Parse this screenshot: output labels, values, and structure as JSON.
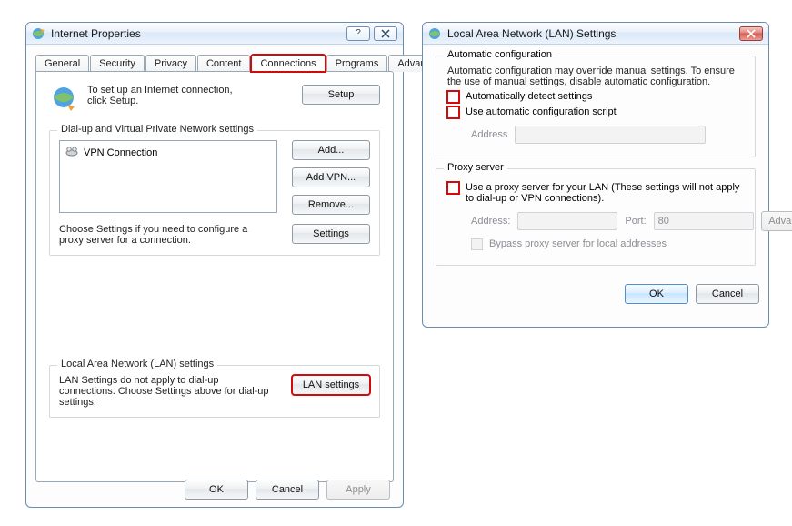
{
  "win1": {
    "title": "Internet Properties",
    "tabs": [
      "General",
      "Security",
      "Privacy",
      "Content",
      "Connections",
      "Programs",
      "Advanced"
    ],
    "active_tab": "Connections",
    "intro": "To set up an Internet connection, click Setup.",
    "setup_btn": "Setup",
    "dialup_legend": "Dial-up and Virtual Private Network settings",
    "vpn_item": "VPN Connection",
    "add_btn": "Add...",
    "add_vpn_btn": "Add VPN...",
    "remove_btn": "Remove...",
    "settings_btn": "Settings",
    "settings_help": "Choose Settings if you need to configure a proxy server for a connection.",
    "lan_legend": "Local Area Network (LAN) settings",
    "lan_help": "LAN Settings do not apply to dial-up connections. Choose Settings above for dial-up settings.",
    "lan_btn": "LAN settings",
    "ok": "OK",
    "cancel": "Cancel",
    "apply": "Apply"
  },
  "win2": {
    "title": "Local Area Network (LAN) Settings",
    "auto_legend": "Automatic configuration",
    "auto_desc": "Automatic configuration may override manual settings.  To ensure the use of manual settings, disable automatic configuration.",
    "auto_detect": "Automatically detect settings",
    "auto_script": "Use automatic configuration script",
    "address_lbl": "Address",
    "proxy_legend": "Proxy server",
    "proxy_use": "Use a proxy server for your LAN (These settings will not apply to dial-up or VPN connections).",
    "proxy_addr_lbl": "Address:",
    "proxy_port_lbl": "Port:",
    "proxy_port_val": "80",
    "advanced_btn": "Advanced",
    "bypass": "Bypass proxy server for local addresses",
    "ok": "OK",
    "cancel": "Cancel"
  }
}
